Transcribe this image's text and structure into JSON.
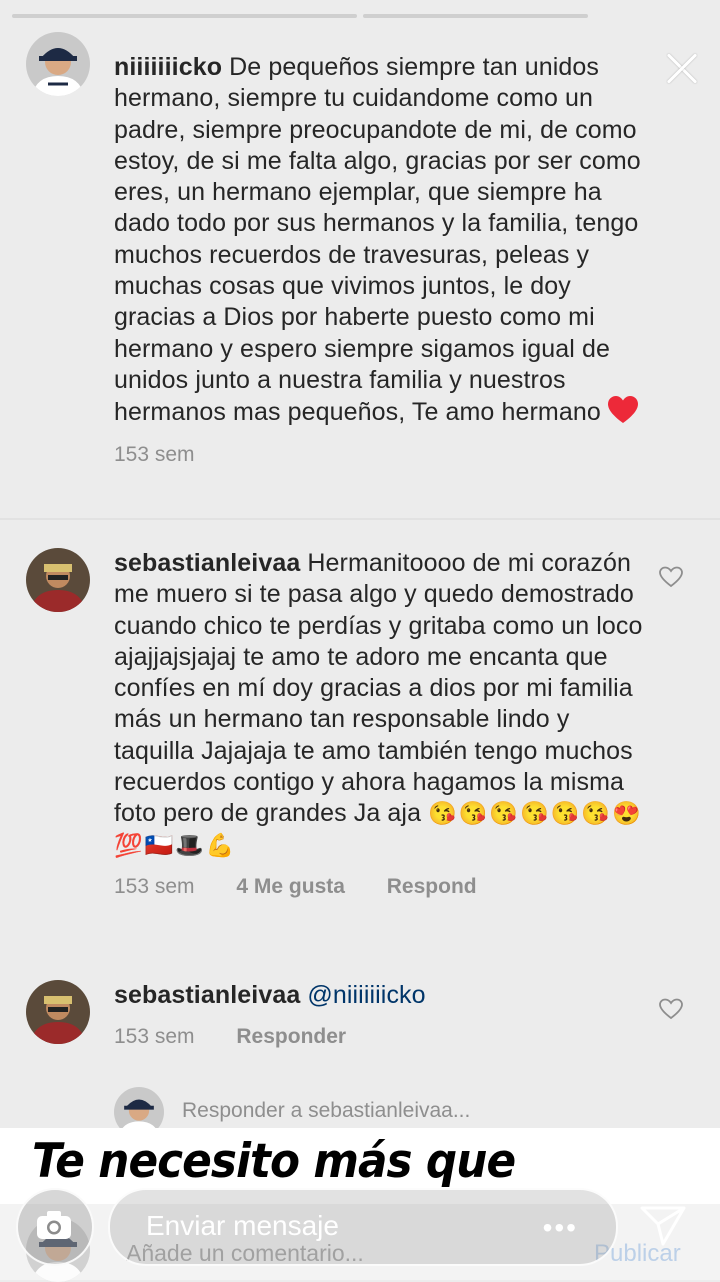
{
  "story": {
    "progress_segments": 2
  },
  "comments": [
    {
      "username": "niiiiiiicko",
      "text": "De pequeños siempre tan unidos hermano, siempre tu cuidandome como un padre, siempre preocupandote de mi, de como estoy, de si me falta algo, gracias por ser como eres, un hermano ejemplar, que siempre ha dado todo por sus hermanos y la familia, tengo muchos recuerdos de travesuras, peleas y muchas cosas que vivimos juntos, le doy gracias a Dios por haberte puesto como mi hermano y espero siempre sigamos igual de unidos junto a nuestra familia y nuestros hermanos mas pequeños, Te amo hermano",
      "time": "153 sem"
    },
    {
      "username": "sebastianleivaa",
      "text": "Hermanitoooo de mi corazón me muero si te pasa algo y quedo demostrado cuando chico te perdías y gritaba como un loco ajajjajsjajaj te amo te adoro me encanta que confíes en mí doy gracias a dios por mi familia más un hermano tan responsable lindo  y taquilla Jajajaja te amo también tengo muchos recuerdos contigo y ahora hagamos la misma foto pero de grandes Ja   aja",
      "emojis": "😘😘😘😘😘😘😍💯🇨🇱🎩💪",
      "time": "153 sem",
      "likes": "4 Me gusta",
      "reply": "Respond"
    },
    {
      "username": "sebastianleivaa",
      "mention": "@niiiiiiicko",
      "time": "153 sem",
      "reply": "Responder"
    }
  ],
  "reply_prompt": "Responder a sebastianleivaa...",
  "story_caption": "Te necesito más que nunca",
  "composer": {
    "placeholder": "Añade un comentario...",
    "publish_label": "Publicar"
  },
  "story_reply": {
    "placeholder": "Enviar mensaje",
    "more": "•••"
  },
  "colors": {
    "heart_red": "#ed2939",
    "mention_blue": "#003569"
  }
}
